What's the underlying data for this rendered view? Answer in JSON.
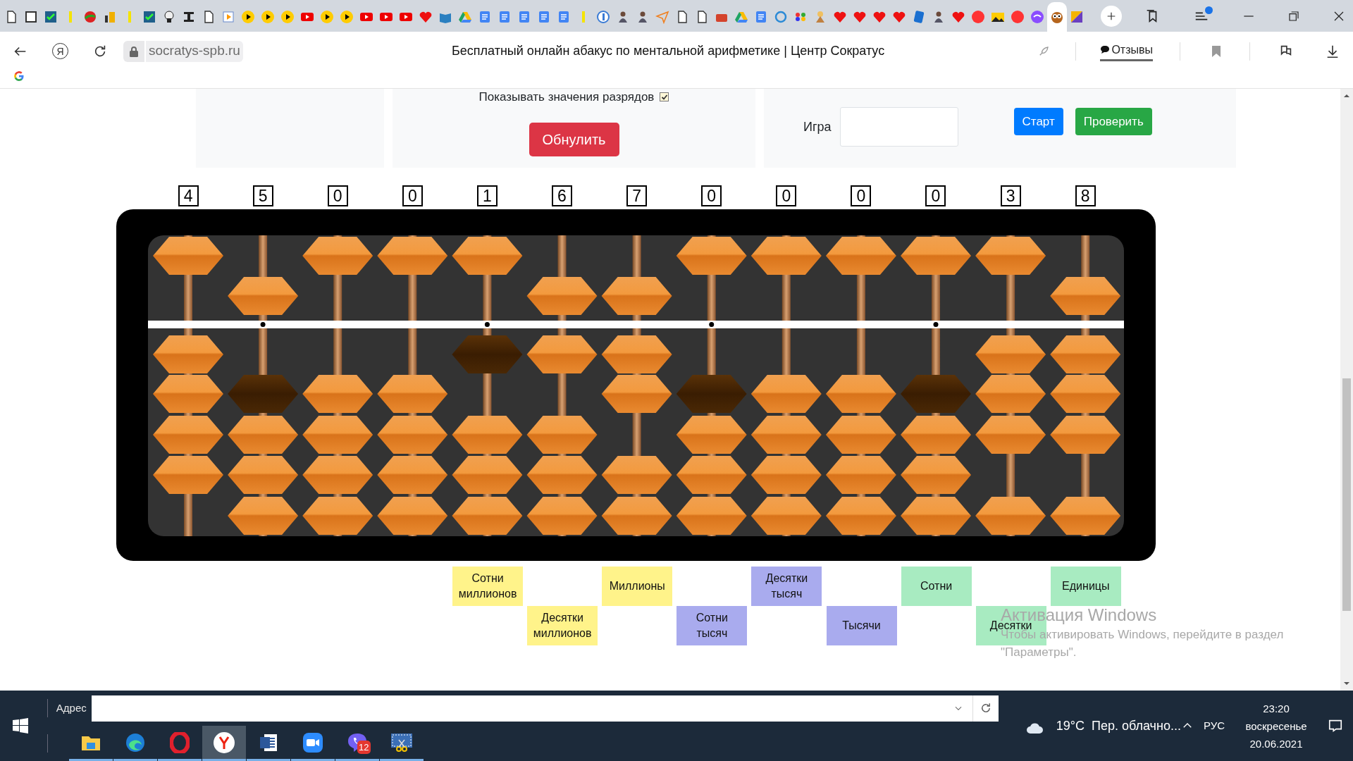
{
  "browser": {
    "tabs": [
      {
        "selected": false
      },
      {
        "selected": false
      },
      {
        "selected": false
      },
      {
        "selected": false
      },
      {
        "selected": false
      },
      {
        "selected": false
      },
      {
        "selected": false
      },
      {
        "selected": false
      },
      {
        "selected": false
      },
      {
        "selected": false
      },
      {
        "selected": false
      },
      {
        "selected": false
      },
      {
        "selected": false
      },
      {
        "selected": false
      },
      {
        "selected": false
      },
      {
        "selected": false
      },
      {
        "selected": false
      },
      {
        "selected": false
      },
      {
        "selected": false
      },
      {
        "selected": false
      },
      {
        "selected": false
      },
      {
        "selected": false
      },
      {
        "selected": false
      },
      {
        "selected": false
      },
      {
        "selected": false
      },
      {
        "selected": false
      },
      {
        "selected": false
      },
      {
        "selected": false
      },
      {
        "selected": false
      },
      {
        "selected": false
      },
      {
        "selected": false
      },
      {
        "selected": false
      },
      {
        "selected": false
      },
      {
        "selected": false
      },
      {
        "selected": false
      },
      {
        "selected": false
      },
      {
        "selected": false
      },
      {
        "selected": false
      },
      {
        "selected": false
      },
      {
        "selected": false
      },
      {
        "selected": false
      },
      {
        "selected": false
      },
      {
        "selected": false
      },
      {
        "selected": false
      },
      {
        "selected": false
      },
      {
        "selected": false
      },
      {
        "selected": false
      },
      {
        "selected": false
      },
      {
        "selected": false
      },
      {
        "selected": false
      },
      {
        "selected": false
      },
      {
        "selected": false
      },
      {
        "selected": false
      },
      {
        "selected": true
      },
      {
        "selected": false
      }
    ],
    "logo": "Я",
    "url": "socratys-spb.ru",
    "title": "Бесплатный онлайн абакус по ментальной арифметике | Центр Сократус",
    "reviews": "Отзывы"
  },
  "settings": {
    "show_values": {
      "label": "Показывать значения разрядов",
      "checked": true
    },
    "reset_button": "Обнулить",
    "game_label": "Игра",
    "start_button": "Старт",
    "check_button": "Проверить"
  },
  "abacus": {
    "rods": [
      {
        "digit": "4",
        "marker": false
      },
      {
        "digit": "5",
        "marker": true
      },
      {
        "digit": "0",
        "marker": false
      },
      {
        "digit": "0",
        "marker": false
      },
      {
        "digit": "1",
        "marker": true
      },
      {
        "digit": "6",
        "marker": false
      },
      {
        "digit": "7",
        "marker": false
      },
      {
        "digit": "0",
        "marker": true
      },
      {
        "digit": "0",
        "marker": false
      },
      {
        "digit": "0",
        "marker": false
      },
      {
        "digit": "0",
        "marker": true
      },
      {
        "digit": "3",
        "marker": false
      },
      {
        "digit": "8",
        "marker": false
      }
    ]
  },
  "place_labels": [
    {
      "text": "Сотни миллионов",
      "color": "#fff38a"
    },
    {
      "text": "Десятки миллионов",
      "color": "#fff38a"
    },
    {
      "text": "Миллионы",
      "color": "#fff38a"
    },
    {
      "text": "Сотни тысяч",
      "color": "#a9abee"
    },
    {
      "text": "Десятки тысяч",
      "color": "#a9abee"
    },
    {
      "text": "Тысячи",
      "color": "#a9abee"
    },
    {
      "text": "Сотни",
      "color": "#a8ebc1"
    },
    {
      "text": "Десятки",
      "color": "#a8ebc1"
    },
    {
      "text": "Единицы",
      "color": "#a8ebc1"
    }
  ],
  "os_notice": {
    "title": "Активация Windows",
    "text_lines": [
      "Чтобы активировать Windows, перейдите в раздел",
      "\"Параметры\"."
    ]
  },
  "taskbar": {
    "address_label": "Адрес",
    "apps": [
      {
        "selected": false
      },
      {
        "selected": false
      },
      {
        "selected": false
      },
      {
        "selected": true
      },
      {
        "selected": false
      },
      {
        "selected": false
      },
      {
        "selected": false,
        "badge": "12"
      },
      {
        "selected": false
      }
    ],
    "temperature": "19°C",
    "weather": "Пер. облачно...",
    "language": "РУС",
    "time": "23:20",
    "weekday": "воскресенье",
    "date": "20.06.2021"
  }
}
